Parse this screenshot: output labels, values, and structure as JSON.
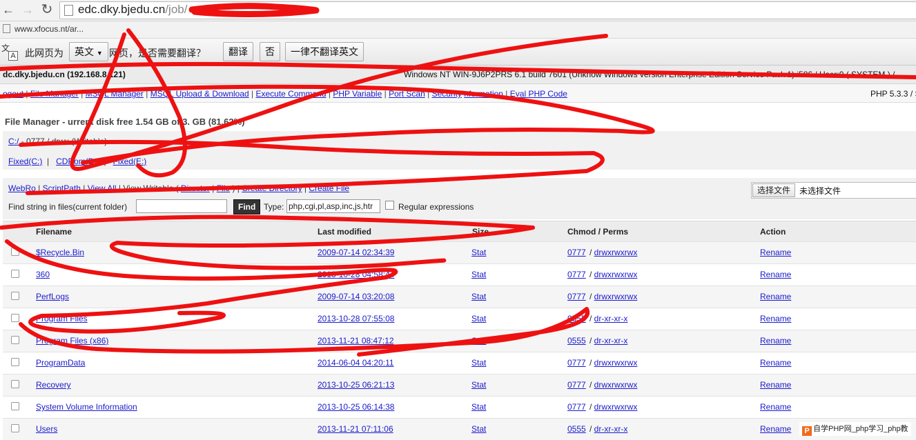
{
  "browser": {
    "url_host": "edc.dky.bjedu.cn",
    "url_path": "/job/",
    "bookmark": "www.xfocus.n",
    "bookmark_tail": "t/ar..."
  },
  "translate": {
    "icon_glyph": "文",
    "icon_letter": "A",
    "prefix": "此网页为",
    "language": "英文",
    "question": "网页，是否需要翻译？",
    "translate_button": "翻译",
    "no_button": "否",
    "never_button": "一律不翻译英文"
  },
  "shell": {
    "host": "dc.dky.bjedu.cn (192.168.8",
    "host_tail": ".121)",
    "os": "Windows NT WIN-9J6P2PRS",
    "os_tail": " 6.1 build 7601 (Unknow Windows version Enterprise Edition Service Pack 1) i586 / User:0 ( SYSTEM ) /",
    "php_version": "PHP 5.3.3 / S",
    "menu": [
      "ogout",
      "File Manager",
      "M",
      "SQL Manager",
      "M",
      "SQL Upload & Download",
      "Execute Command",
      "PHP Variable",
      "Port Scan",
      "Security",
      "nformation",
      "Eval PHP Code"
    ]
  },
  "file_manager": {
    "title_a": "File Manager - ",
    "title_b": "urrent disk free 1.54 GB of 3.",
    "title_c": " GB (81.62%)",
    "path_link": "C:/",
    "path_perm": " - 0777 / drw",
    "path_perm_tail": "x (Writable)",
    "drives": [
      "Fixed(C:)",
      "CDRom(D:)",
      "Fixed(E:)"
    ],
    "tools": [
      "WebRo",
      "ScriptPath",
      "View All"
    ],
    "tools_text": "View Writable",
    "tools_more": [
      "Director",
      "File",
      "Create Directory",
      "Create File"
    ],
    "upload_button": "选择文件",
    "upload_status": "未选择文件",
    "find_label": "Find string in files(current folder)",
    "find_button": "Find",
    "type_label": "Type:",
    "type_value": "php,cgi,pl,asp,inc,js,htr",
    "regex_label": "Regular expressions"
  },
  "table": {
    "headers": {
      "filename": "Filename",
      "modified": "Last modified",
      "size": "Size",
      "chmod": "Chmod",
      "perms": "Perms",
      "action": "Action"
    },
    "rows": [
      {
        "name": "$Recycle.Bin",
        "modified": "2009-07-14 02:34:39",
        "size": "Stat",
        "chmod": "0777",
        "perms": "drwxrwxrwx",
        "action": "Rename"
      },
      {
        "name": "360",
        "modified": "2013-10-28 04:58:44",
        "size": "Stat",
        "chmod": "0777",
        "perms": "drwxrwxrwx",
        "action": "Rename"
      },
      {
        "name": "PerfLogs",
        "modified": "2009-07-14 03:20:08",
        "size": "Stat",
        "chmod": "0777",
        "perms": "drwxrwxrwx",
        "action": "Rename"
      },
      {
        "name": "Program Files",
        "modified": "2013-10-28 07:55:08",
        "size": "Stat",
        "chmod": "0555",
        "perms": "dr-xr-xr-x",
        "action": "Rename"
      },
      {
        "name": "Program Files (x86)",
        "modified": "2013-11-21 08:47:12",
        "size": "Stat",
        "chmod": "0555",
        "perms": "dr-xr-xr-x",
        "action": "Rename"
      },
      {
        "name": "ProgramData",
        "modified": "2014-06-04 04:20:11",
        "size": "Stat",
        "chmod": "0777",
        "perms": "drwxrwxrwx",
        "action": "Rename"
      },
      {
        "name": "Recovery",
        "modified": "2013-10-25 06:21:13",
        "size": "Stat",
        "chmod": "0777",
        "perms": "drwxrwxrwx",
        "action": "Rename"
      },
      {
        "name": "System Volume Information",
        "modified": "2013-10-25 06:14:38",
        "size": "Stat",
        "chmod": "0777",
        "perms": "drwxrwxrwx",
        "action": "Rename"
      },
      {
        "name": "Users",
        "modified": "2013-11-21 07:11:06",
        "size": "Stat",
        "chmod": "0555",
        "perms": "dr-xr-xr-x",
        "action": "Rename"
      }
    ]
  },
  "watermark": {
    "logo": "P",
    "text": "自学PHP网_php学习_php教"
  },
  "colors": {
    "link": "#1a1acc",
    "scribble": "#ee1111"
  }
}
